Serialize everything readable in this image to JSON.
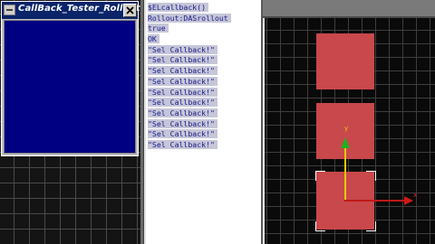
{
  "rollout": {
    "title": "CallBack_Tester_Rollout",
    "close_icon": "close-icon",
    "menu_icon": "system-menu-icon"
  },
  "listener": {
    "lines": [
      "$ELcallback()",
      "Rollout:DASrollout",
      "true",
      "OK",
      "\"Sel Callback!\"",
      "\"Sel Callback!\"",
      "\"Sel Callback!\"",
      "\"Sel Callback!\"",
      "\"Sel Callback!\"",
      "\"Sel Callback!\"",
      "\"Sel Callback!\"",
      "\"Sel Callback!\"",
      "\"Sel Callback!\"",
      "\"Sel Callback!\""
    ]
  },
  "viewport": {
    "object_color": "#c8484c",
    "gizmo": {
      "x_axis_label": "x",
      "y_axis_label": "y",
      "x_color": "#c01818",
      "y_color": "#e8c800"
    }
  }
}
